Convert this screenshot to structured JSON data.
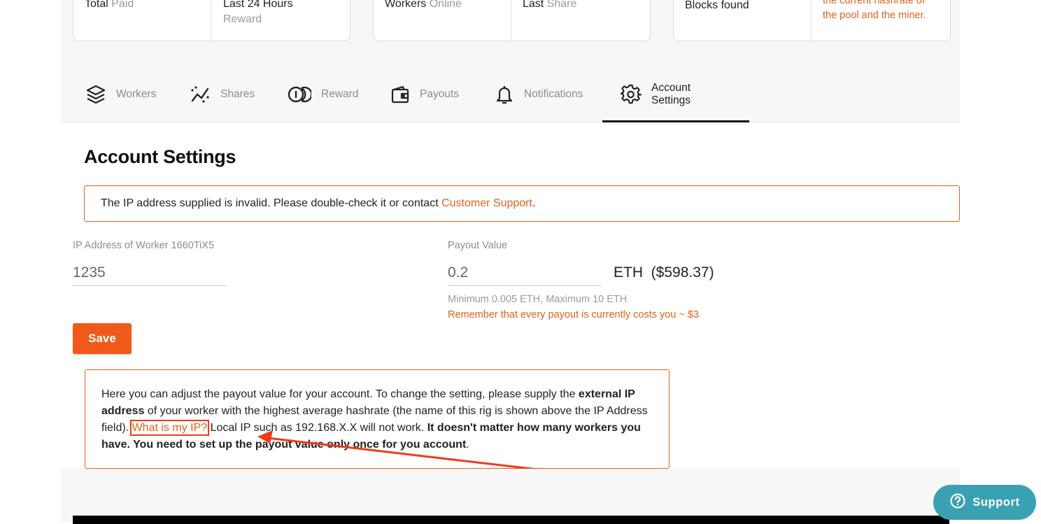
{
  "stats": {
    "card1": {
      "total_main": "Total",
      "total_muted": "Paid",
      "reward_main": "Last 24 Hours",
      "reward_muted": "Reward"
    },
    "card2": {
      "workers_main": "Workers",
      "workers_muted": "Online",
      "share_main": "Last",
      "share_muted": "Share"
    },
    "card3": {
      "blocks": "Blocks found",
      "note_line1": "the current hashrate of",
      "note_line2": "the pool and the miner."
    }
  },
  "tabs": [
    {
      "label": "Workers",
      "icon": "layers-icon"
    },
    {
      "label": "Shares",
      "icon": "chart-line-icon"
    },
    {
      "label": "Reward",
      "icon": "coins-icon"
    },
    {
      "label": "Payouts",
      "icon": "wallet-icon"
    },
    {
      "label": "Notifications",
      "icon": "bell-icon"
    },
    {
      "label": "Account Settings",
      "icon": "gear-icon",
      "active": true
    }
  ],
  "page": {
    "title": "Account Settings"
  },
  "alert": {
    "text": "The IP address supplied is invalid. Please double-check it or contact ",
    "link": "Customer Support",
    "suffix": "."
  },
  "form": {
    "ip_label": "IP Address of Worker 1660TiX5",
    "ip_value": "1235",
    "payout_label": "Payout Value",
    "payout_value": "0.2",
    "currency": "ETH",
    "usd_value": "($598.37)",
    "limits_hint": "Minimum 0.005 ETH, Maximum 10 ETH",
    "cost_hint": "Remember that every payout is currently costs you ~ $3",
    "save_label": "Save"
  },
  "info": {
    "p1": "Here you can adjust the payout value for your account. To change the setting, please supply the ",
    "b1": "external IP address",
    "p2": " of your worker with the highest average hashrate (the name of this rig is shown above the IP Address field). ",
    "link": "What is my IP?",
    "p3": " Local IP such as 192.168.X.X will not work. ",
    "b2": "It doesn't matter how many workers you have. You need to set up the payout value only once for you account",
    "p4": "."
  },
  "support": {
    "label": "Support",
    "icon": "question-circle-icon"
  },
  "colors": {
    "accent": "#ef5a1a",
    "accent_text": "#e0621c",
    "support_bg": "#3aa1b3",
    "annotation": "#ef3a1a"
  }
}
